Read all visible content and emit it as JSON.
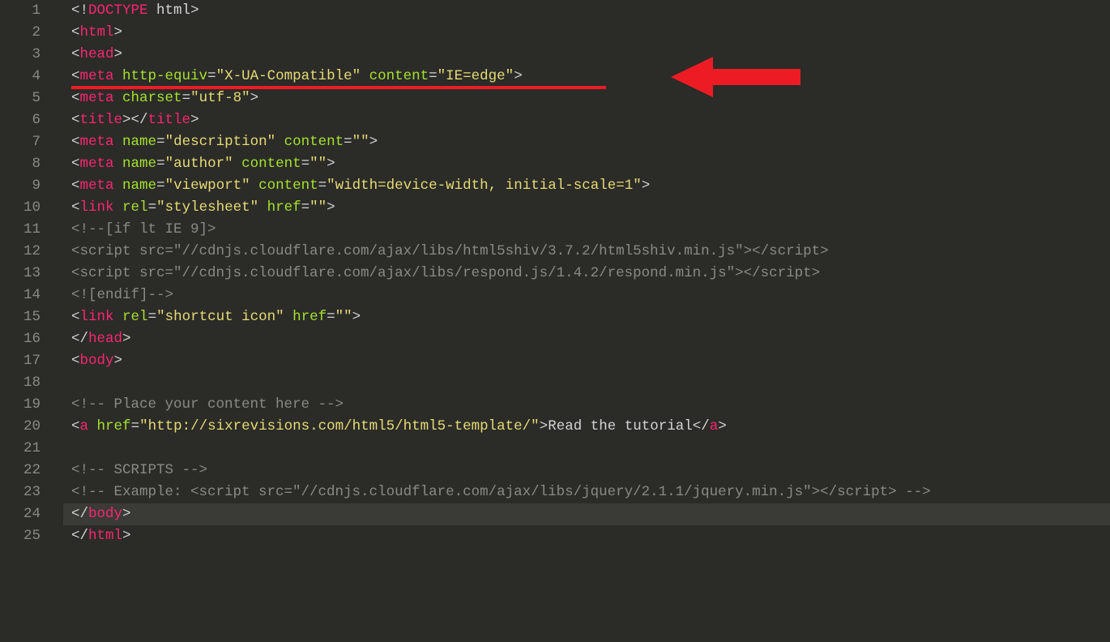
{
  "gutter": [
    "1",
    "2",
    "3",
    "4",
    "5",
    "6",
    "7",
    "8",
    "9",
    "10",
    "11",
    "12",
    "13",
    "14",
    "15",
    "16",
    "17",
    "18",
    "19",
    "20",
    "21",
    "22",
    "23",
    "24",
    "25"
  ],
  "lines": {
    "l1": {
      "open": "<!",
      "doctype": "DOCTYPE",
      "space": " ",
      "html": "html",
      "close": ">"
    },
    "l2": {
      "open": "<",
      "tag": "html",
      "close": ">"
    },
    "l3": {
      "open": "<",
      "tag": "head",
      "close": ">"
    },
    "l4": {
      "open": "<",
      "tag": "meta",
      "sp1": " ",
      "a1": "http-equiv",
      "eq1": "=",
      "v1": "\"X-UA-Compatible\"",
      "sp2": " ",
      "a2": "content",
      "eq2": "=",
      "v2": "\"IE=edge\"",
      "close": ">"
    },
    "l5": {
      "open": "<",
      "tag": "meta",
      "sp1": " ",
      "a1": "charset",
      "eq1": "=",
      "v1": "\"utf-8\"",
      "close": ">"
    },
    "l6": {
      "open": "<",
      "tag": "title",
      "mid": "></",
      "tag2": "title",
      "close": ">"
    },
    "l7": {
      "open": "<",
      "tag": "meta",
      "sp1": " ",
      "a1": "name",
      "eq1": "=",
      "v1": "\"description\"",
      "sp2": " ",
      "a2": "content",
      "eq2": "=",
      "v2": "\"\"",
      "close": ">"
    },
    "l8": {
      "open": "<",
      "tag": "meta",
      "sp1": " ",
      "a1": "name",
      "eq1": "=",
      "v1": "\"author\"",
      "sp2": " ",
      "a2": "content",
      "eq2": "=",
      "v2": "\"\"",
      "close": ">"
    },
    "l9": {
      "open": "<",
      "tag": "meta",
      "sp1": " ",
      "a1": "name",
      "eq1": "=",
      "v1": "\"viewport\"",
      "sp2": " ",
      "a2": "content",
      "eq2": "=",
      "v2": "\"width=device-width, initial-scale=1\"",
      "close": ">"
    },
    "l10": {
      "open": "<",
      "tag": "link",
      "sp1": " ",
      "a1": "rel",
      "eq1": "=",
      "v1": "\"stylesheet\"",
      "sp2": " ",
      "a2": "href",
      "eq2": "=",
      "v2": "\"\"",
      "close": ">"
    },
    "l11": {
      "text": "<!--[if lt IE 9]>"
    },
    "l12": {
      "text": "<script src=\"//cdnjs.cloudflare.com/ajax/libs/html5shiv/3.7.2/html5shiv.min.js\"></script>"
    },
    "l13": {
      "text": "<script src=\"//cdnjs.cloudflare.com/ajax/libs/respond.js/1.4.2/respond.min.js\"></script>"
    },
    "l14": {
      "text": "<![endif]-->"
    },
    "l15": {
      "open": "<",
      "tag": "link",
      "sp1": " ",
      "a1": "rel",
      "eq1": "=",
      "v1": "\"shortcut icon\"",
      "sp2": " ",
      "a2": "href",
      "eq2": "=",
      "v2": "\"\"",
      "close": ">"
    },
    "l16": {
      "open": "</",
      "tag": "head",
      "close": ">"
    },
    "l17": {
      "open": "<",
      "tag": "body",
      "close": ">"
    },
    "l19": {
      "text": "<!-- Place your content here -->"
    },
    "l20": {
      "open": "<",
      "tag": "a",
      "sp1": " ",
      "a1": "href",
      "eq1": "=",
      "v1": "\"http://sixrevisions.com/html5/html5-template/\"",
      "close": ">",
      "content": "Read the tutorial",
      "open2": "</",
      "tag2": "a",
      "close2": ">"
    },
    "l22": {
      "text": "<!-- SCRIPTS -->"
    },
    "l23": {
      "text": "<!-- Example: <script src=\"//cdnjs.cloudflare.com/ajax/libs/jquery/2.1.1/jquery.min.js\"></script> -->"
    },
    "l24": {
      "open": "</",
      "tag": "body",
      "close": ">"
    },
    "l25": {
      "open": "</",
      "tag": "html",
      "close": ">"
    }
  }
}
